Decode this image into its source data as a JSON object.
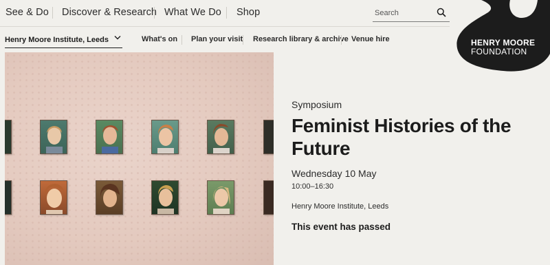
{
  "top_nav": {
    "items": [
      "See & Do",
      "Discover & Research",
      "What We Do",
      "Shop"
    ]
  },
  "search": {
    "placeholder": "Search",
    "icon": "search-icon"
  },
  "logo": {
    "line1": "HENRY MOORE",
    "line2": "FOUNDATION",
    "color": "#1c1c1c"
  },
  "sub_nav": {
    "venue": "Henry Moore Institute, Leeds",
    "links": [
      "What's on",
      "Plan your visit",
      "Research library & archive",
      "Venue hire"
    ]
  },
  "hero": {
    "alt_subject": "gallery-wall-portraits"
  },
  "event": {
    "type": "Symposium",
    "title": "Feminist Histories of the Future",
    "date": "Wednesday 10 May",
    "time": "10:00–16:30",
    "location": "Henry Moore Institute, Leeds",
    "status": "This event has passed"
  },
  "colors": {
    "background": "#f1f0ec",
    "text": "#1c1c1c",
    "wall": "#e4cabf"
  }
}
